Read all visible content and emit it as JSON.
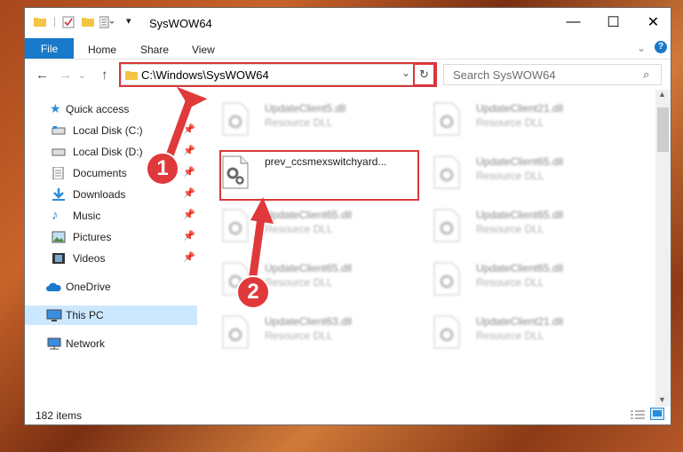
{
  "window": {
    "title": "SysWOW64"
  },
  "ribbon": {
    "file": "File",
    "home": "Home",
    "share": "Share",
    "view": "View"
  },
  "address": {
    "path": "C:\\Windows\\SysWOW64"
  },
  "search": {
    "placeholder": "Search SysWOW64"
  },
  "nav": {
    "items": [
      {
        "label": "Quick access"
      },
      {
        "label": "Local Disk (C:)"
      },
      {
        "label": "Local Disk (D:)"
      },
      {
        "label": "Documents"
      },
      {
        "label": "Downloads"
      },
      {
        "label": "Music"
      },
      {
        "label": "Pictures"
      },
      {
        "label": "Videos"
      },
      {
        "label": "OneDrive"
      },
      {
        "label": "This PC"
      },
      {
        "label": "Network"
      }
    ]
  },
  "files": {
    "main": {
      "name": "prev_ccsmexswitchyard...",
      "type": ""
    },
    "left": [
      {
        "name": "UpdateClient5.dll",
        "type": "Resource DLL"
      },
      {
        "name": "UpdateClient65.dll",
        "type": "Resource DLL"
      },
      {
        "name": "UpdateClient65.dll",
        "type": "Resource DLL"
      },
      {
        "name": "UpdateClient63.dll",
        "type": "Resource DLL"
      }
    ],
    "right": [
      {
        "name": "UpdateClient21.dll",
        "type": "Resource DLL"
      },
      {
        "name": "UpdateClient65.dll",
        "type": "Resource DLL"
      },
      {
        "name": "UpdateClient65.dll",
        "type": "Resource DLL"
      },
      {
        "name": "UpdateClient65.dll",
        "type": "Resource DLL"
      },
      {
        "name": "UpdateClient21.dll",
        "type": "Resource DLL"
      }
    ]
  },
  "status": {
    "items": "182 items"
  },
  "callouts": {
    "one": "1",
    "two": "2"
  },
  "colors": {
    "accent": "#1979ca",
    "highlight": "#d9383a",
    "selected": "#cce8ff"
  }
}
